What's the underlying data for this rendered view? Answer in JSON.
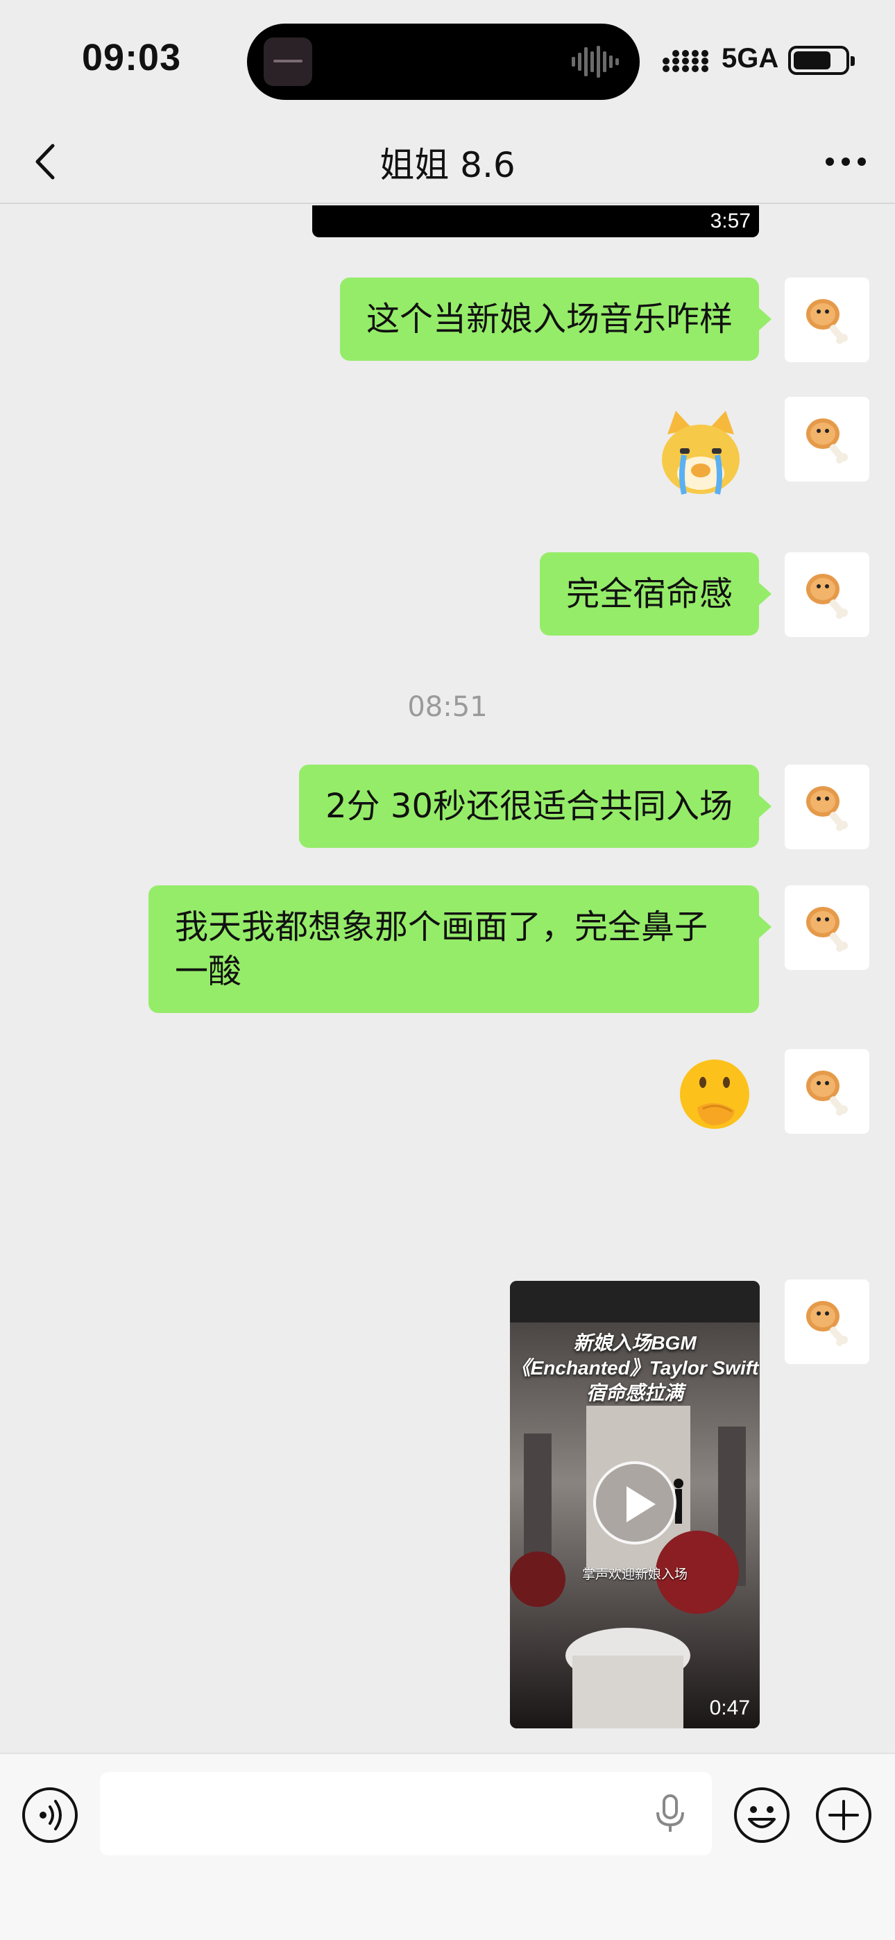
{
  "status_bar": {
    "time": "09:03",
    "network": "5GA",
    "battery_level": 0.74
  },
  "header": {
    "title": "姐姐 8.6"
  },
  "messages": {
    "prev_video_duration": "3:57",
    "m1": "这个当新娘入场音乐咋样",
    "m2_sticker": "crying-cat-sticker",
    "m3": "完全宿命感",
    "timestamp": "08:51",
    "m4": "2分 30秒还很适合共同入场",
    "m5": "我天我都想象那个画面了，完全鼻子一酸",
    "m6_sticker": "hand-over-mouth-emoji",
    "video": {
      "title_line1": "新娘入场BGM",
      "title_line2": "《Enchanted》Taylor Swift",
      "title_line3": "宿命感拉满",
      "caption": "掌声欢迎新娘入场",
      "duration": "0:47"
    }
  },
  "colors": {
    "bubble_sent": "#95ec69",
    "background": "#ededed"
  },
  "icons": {
    "avatar": "drumstick-avatar-icon",
    "back": "chevron-left-icon",
    "more": "more-icon",
    "voice": "voice-icon",
    "mic": "microphone-icon",
    "emoji": "emoji-icon",
    "plus": "plus-icon"
  }
}
